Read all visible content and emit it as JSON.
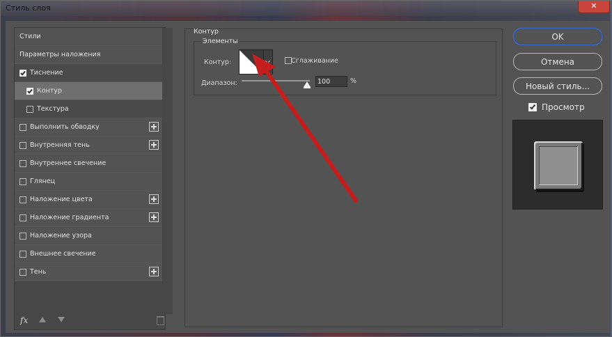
{
  "window": {
    "title": "Стиль слоя",
    "close_glyph": "✕"
  },
  "left_panel": {
    "items": [
      {
        "label": "Стили",
        "checkbox": false,
        "checked": false,
        "plus": false
      },
      {
        "label": "Параметры наложения",
        "checkbox": false,
        "checked": false,
        "plus": false
      },
      {
        "label": "Тиснение",
        "checkbox": true,
        "checked": true,
        "plus": false
      },
      {
        "label": "Контур",
        "checkbox": true,
        "checked": true,
        "plus": false,
        "sub": true,
        "selected": true
      },
      {
        "label": "Текстура",
        "checkbox": true,
        "checked": false,
        "plus": false,
        "sub": true
      },
      {
        "label": "Выполнить обводку",
        "checkbox": true,
        "checked": false,
        "plus": true
      },
      {
        "label": "Внутренняя тень",
        "checkbox": true,
        "checked": false,
        "plus": true
      },
      {
        "label": "Внутреннее свечение",
        "checkbox": true,
        "checked": false,
        "plus": false
      },
      {
        "label": "Глянец",
        "checkbox": true,
        "checked": false,
        "plus": false
      },
      {
        "label": "Наложение цвета",
        "checkbox": true,
        "checked": false,
        "plus": true
      },
      {
        "label": "Наложение градиента",
        "checkbox": true,
        "checked": false,
        "plus": true
      },
      {
        "label": "Наложение узора",
        "checkbox": true,
        "checked": false,
        "plus": false
      },
      {
        "label": "Внешнее свечение",
        "checkbox": true,
        "checked": false,
        "plus": false
      },
      {
        "label": "Тень",
        "checkbox": true,
        "checked": false,
        "plus": true
      }
    ],
    "footer": {
      "fx_label": "fx",
      "icons": [
        "fx-icon",
        "move-up-icon",
        "move-down-icon",
        "trash-icon"
      ]
    }
  },
  "center": {
    "group_title": "Контур",
    "subgroup_title": "Элементы",
    "contour_label": "Контур:",
    "smoothing_label": "Сглаживание",
    "smoothing_checked": false,
    "range_label": "Диапазон:",
    "range_value": "100",
    "range_unit": "%",
    "range_fraction": 1.0
  },
  "right": {
    "ok_label": "OK",
    "cancel_label": "Отмена",
    "new_style_label": "Новый стиль...",
    "preview_label": "Просмотр",
    "preview_checked": true
  },
  "colors": {
    "annotation_arrow": "#c41e1e",
    "ok_border": "#3f6fd6",
    "close_button": "#c9453b"
  }
}
